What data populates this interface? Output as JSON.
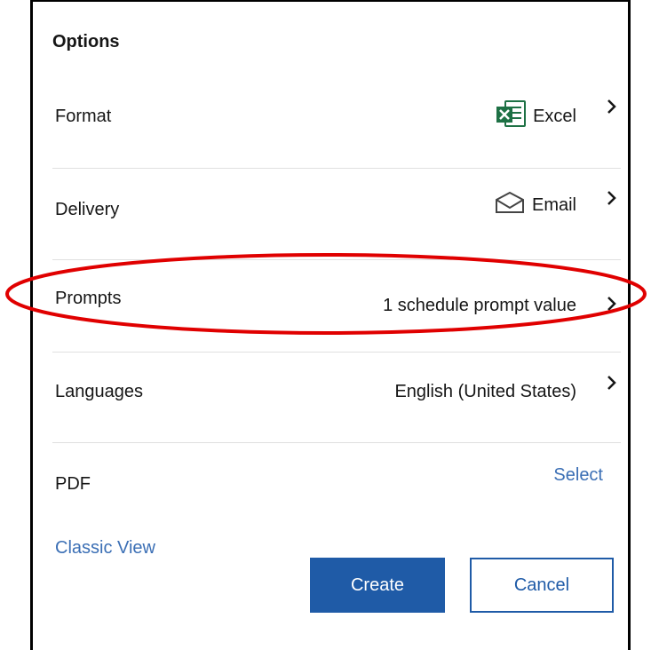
{
  "options": {
    "heading": "Options",
    "rows": [
      {
        "label": "Format",
        "value": "Excel",
        "icon": "excel-icon",
        "chevron": true
      },
      {
        "label": "Delivery",
        "value": "Email",
        "icon": "envelope-icon",
        "chevron": true
      },
      {
        "label": "Prompts",
        "value": "1 schedule prompt value",
        "chevron": true
      },
      {
        "label": "Languages",
        "value": "English (United States)",
        "chevron": true
      },
      {
        "label": "PDF",
        "value": "Select",
        "chevron": false
      }
    ],
    "classic_view": "Classic View"
  },
  "actions": {
    "create_label": "Create",
    "cancel_label": "Cancel"
  },
  "colors": {
    "primary": "#1f5ba7",
    "link": "#3b6fb5",
    "excel_green": "#1e7145",
    "highlight_red": "#e00000",
    "divider": "#e0e0e0"
  }
}
